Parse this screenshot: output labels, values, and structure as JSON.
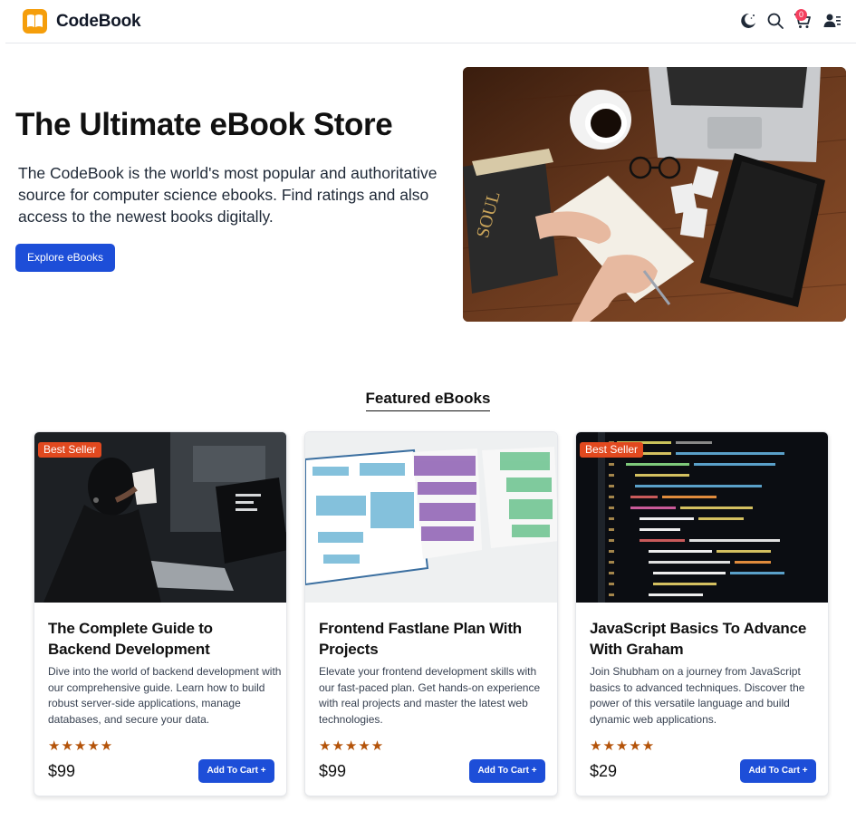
{
  "header": {
    "brand": "CodeBook",
    "cart_count": "0",
    "icons": [
      "logo-icon",
      "dark-mode-icon",
      "search-icon",
      "cart-icon",
      "user-icon"
    ]
  },
  "hero": {
    "title": "The Ultimate eBook Store",
    "description": "The CodeBook is the world's most popular and authoritative source for computer science ebooks. Find ratings and also access to the newest books digitally.",
    "button_label": "Explore eBooks"
  },
  "featured": {
    "heading": "Featured eBooks",
    "cards": [
      {
        "badge": "Best Seller",
        "title": "The Complete Guide to Backend Development",
        "description": "Dive into the world of backend development with our comprehensive guide. Learn how to build robust server-side applications, manage databases, and secure your data.",
        "rating": 5,
        "stars": "★★★★★",
        "price": "$99",
        "button_label": "Add To Cart +"
      },
      {
        "badge": "",
        "title": "Frontend Fastlane Plan With Projects",
        "description": "Elevate your frontend development skills with our fast-paced plan. Get hands-on experience with real projects and master the latest web technologies.",
        "rating": 5,
        "stars": "★★★★★",
        "price": "$99",
        "button_label": "Add To Cart +"
      },
      {
        "badge": "Best Seller",
        "title": "JavaScript Basics To Advance With Graham",
        "description": "Join Shubham on a journey from JavaScript basics to advanced techniques. Discover the power of this versatile language and build dynamic web applications.",
        "rating": 5,
        "stars": "★★★★★",
        "price": "$29",
        "button_label": "Add To Cart +"
      }
    ]
  },
  "colors": {
    "primary": "#1d4ed8",
    "badge": "#e1491f",
    "star": "#b45309",
    "cart_badge": "#f43f5e",
    "logo": "#f59e0b"
  }
}
